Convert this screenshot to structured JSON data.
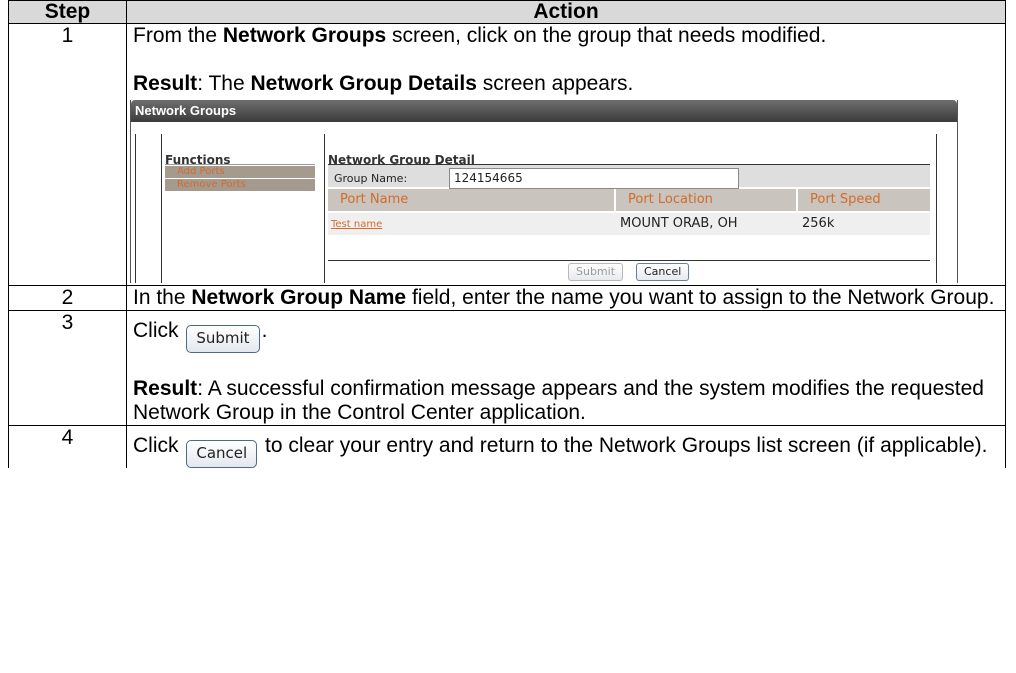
{
  "header": {
    "step": "Step",
    "action": "Action"
  },
  "rows": [
    {
      "step": "1",
      "pre": "From the ",
      "bold": "Network Groups",
      "post": " screen, click on the group that needs modified.",
      "result_label": "Result",
      "result_pre": ":  The ",
      "result_bold": "Network Group Details",
      "result_post": " screen appears."
    },
    {
      "step": "2",
      "pre": "In the ",
      "bold": "Network Group Name",
      "post": " field, enter the name you want to assign to the Network Group."
    },
    {
      "step": "3",
      "pre": "Click ",
      "button": "Submit",
      "post": ".",
      "result_label": "Result",
      "result_text": ": A successful confirmation message appears and the system modifies the requested Network Group in the Control Center application."
    },
    {
      "step": "4",
      "pre": "Click ",
      "button": "Cancel",
      "post": " to clear your entry and return to the Network Groups list screen (if applicable)."
    }
  ],
  "screenshot": {
    "title": "Network Groups",
    "functions_heading": "Functions",
    "functions": [
      "Add Ports",
      "Remove Ports"
    ],
    "detail_heading": "Network Group Detail",
    "group_name_label": "Group Name:",
    "group_name_value": "124154665",
    "columns": [
      "Port Name",
      "Port Location",
      "Port Speed"
    ],
    "row": {
      "port_name": "Test name",
      "port_location": "MOUNT ORAB, OH",
      "port_speed": "256k"
    },
    "submit_label": "Submit",
    "cancel_label": "Cancel"
  },
  "colors": {
    "link_orange": "#d46b2a",
    "header_gray": "#d9d9d9",
    "function_bg": "#a49a8e"
  }
}
